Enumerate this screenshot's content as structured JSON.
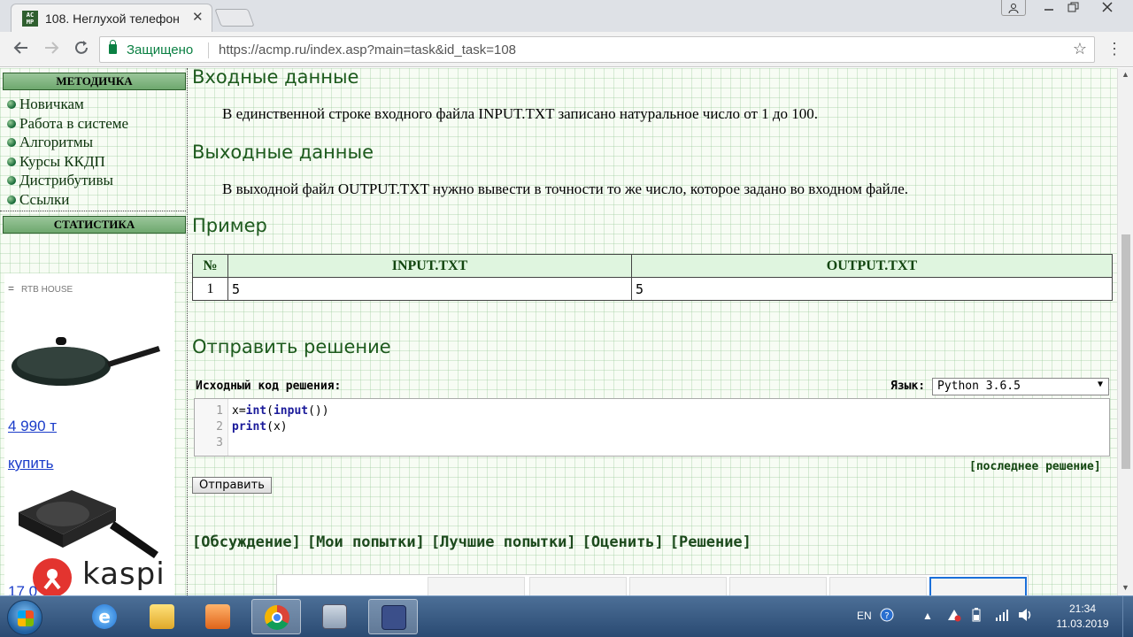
{
  "browser": {
    "tab_title": "108. Неглухой телефон",
    "tab_favicon_text": "AC MP",
    "tab_close": "✕",
    "secure_label": "Защищено",
    "url": "https://acmp.ru/index.asp?main=task&id_task=108"
  },
  "sidebar": {
    "methodology_title": "МЕТОДИЧКА",
    "items": [
      {
        "label": "Новичкам"
      },
      {
        "label": "Работа в системе"
      },
      {
        "label": "Алгоритмы"
      },
      {
        "label": "Курсы ККДП"
      },
      {
        "label": "Дистрибутивы"
      },
      {
        "label": "Ссылки"
      }
    ],
    "statistics_title": "СТАТИСТИКА",
    "ad": {
      "top_label": "RTB HOUSE",
      "price": "4 990 т",
      "buy": "купить",
      "brand": "kaspi",
      "partial_price": "17 0"
    }
  },
  "task": {
    "input_heading": "Входные данные",
    "input_text": "В единственной строке входного файла INPUT.TXT записано натуральное число от 1 до 100.",
    "output_heading": "Выходные данные",
    "output_text": "В выходной файл OUTPUT.TXT нужно вывести в точности то же число, которое задано во входном файле.",
    "example_heading": "Пример",
    "example_table": {
      "headers": [
        "№",
        "INPUT.TXT",
        "OUTPUT.TXT"
      ],
      "rows": [
        [
          "1",
          "5",
          "5"
        ]
      ]
    }
  },
  "submit": {
    "heading": "Отправить решение",
    "source_label": "Исходный код решения:",
    "language_label": "Язык:",
    "language_value": "Python 3.6.5",
    "code_lines": [
      {
        "number": "1",
        "text": "x=int(input())"
      },
      {
        "number": "2",
        "text": "print(x)"
      },
      {
        "number": "3",
        "text": ""
      }
    ],
    "last_solution_link": "[последнее решение]",
    "submit_button": "Отправить"
  },
  "task_links": [
    {
      "label": "[Обсуждение]"
    },
    {
      "label": "[Мои попытки]"
    },
    {
      "label": "[Лучшие попытки]"
    },
    {
      "label": "[Оценить]"
    },
    {
      "label": "[Решение]"
    }
  ],
  "taskbar": {
    "language": "EN",
    "time": "21:34",
    "date": "11.03.2019"
  },
  "colors": {
    "heading_green": "#1d5a1d",
    "secure_green": "#0b8043",
    "link_blue": "#1a3cc9"
  },
  "icons": [
    "back-icon",
    "forward-icon",
    "reload-icon",
    "lock-icon",
    "star-icon",
    "menu-icon",
    "start-icon",
    "ie-icon",
    "explorer-icon",
    "media-icon",
    "chrome-icon",
    "calculator-icon",
    "floppy-icon"
  ]
}
